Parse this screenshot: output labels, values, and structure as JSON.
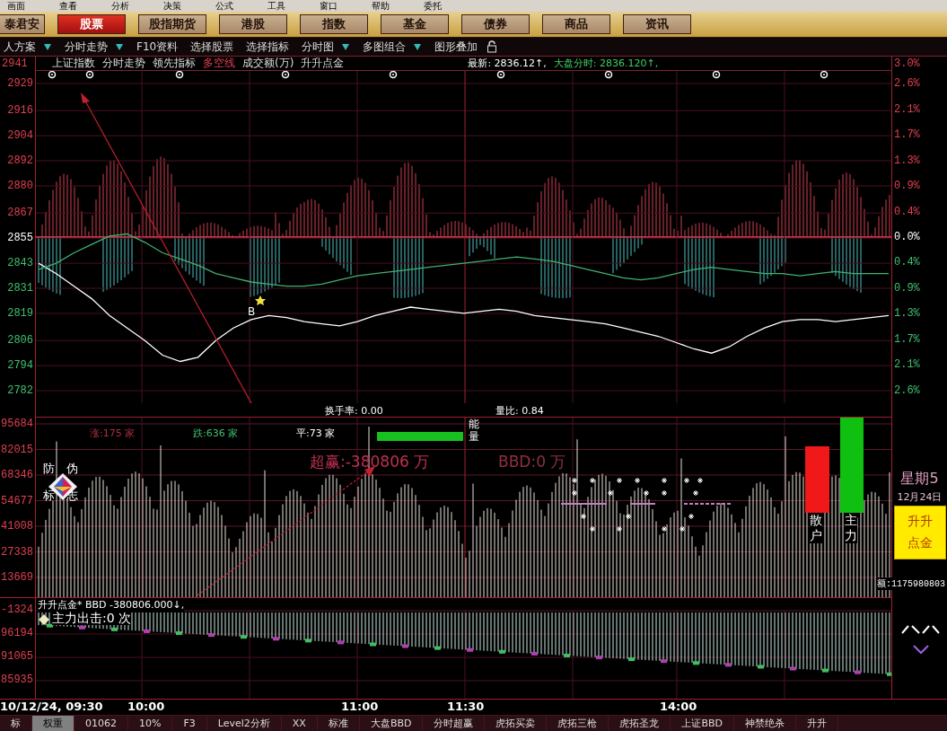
{
  "menu_bar": [
    "画面",
    "查看",
    "分析",
    "决策",
    "公式",
    "工具",
    "窗口",
    "帮助",
    "委托"
  ],
  "market_buttons": [
    {
      "label": "泰君安",
      "selected": false
    },
    {
      "label": "股票",
      "selected": true
    },
    {
      "label": "股指期货",
      "selected": false
    },
    {
      "label": "港股",
      "selected": false
    },
    {
      "label": "指数",
      "selected": false
    },
    {
      "label": "基金",
      "selected": false
    },
    {
      "label": "债券",
      "selected": false
    },
    {
      "label": "商品",
      "selected": false
    },
    {
      "label": "资讯",
      "selected": false
    }
  ],
  "toolbar": [
    {
      "label": "人方案",
      "dropdown": true
    },
    {
      "label": "分时走势",
      "dropdown": true
    },
    {
      "label": "F10资料",
      "dropdown": false
    },
    {
      "label": "选择股票",
      "dropdown": false
    },
    {
      "label": "选择指标",
      "dropdown": false
    },
    {
      "label": "分时图",
      "dropdown": true
    },
    {
      "label": "多图组合",
      "dropdown": true
    },
    {
      "label": "图形叠加",
      "dropdown": false
    }
  ],
  "chart_header": {
    "items": [
      {
        "text": "上证指数",
        "kind": "normal"
      },
      {
        "text": "分时走势",
        "kind": "normal"
      },
      {
        "text": "领先指标",
        "kind": "normal"
      },
      {
        "text": "多空线",
        "kind": "highlight"
      },
      {
        "text": "成交额(万)",
        "kind": "normal"
      },
      {
        "text": "升升点金",
        "kind": "normal"
      }
    ],
    "latest": "最新: 2836.12↑,",
    "index_timeshare": "大盘分时: 2836.120↑,"
  },
  "price_axis_top": {
    "label": "2941",
    "kind": "up"
  },
  "percent_axis": [
    {
      "label": "3.0%",
      "kind": "up"
    },
    {
      "label": "2.6%",
      "kind": "up"
    },
    {
      "label": "2.1%",
      "kind": "up"
    },
    {
      "label": "1.7%",
      "kind": "up"
    },
    {
      "label": "1.3%",
      "kind": "up"
    },
    {
      "label": "0.9%",
      "kind": "up"
    },
    {
      "label": "0.4%",
      "kind": "up"
    },
    {
      "label": "0.0%",
      "kind": "flat"
    },
    {
      "label": "0.4%",
      "kind": "down"
    },
    {
      "label": "0.9%",
      "kind": "down"
    },
    {
      "label": "1.3%",
      "kind": "down"
    },
    {
      "label": "1.7%",
      "kind": "down"
    },
    {
      "label": "2.1%",
      "kind": "down"
    },
    {
      "label": "2.6%",
      "kind": "down"
    }
  ],
  "price_chart": {
    "chart_data": {
      "type": "line",
      "ylim": [
        2776,
        2935
      ],
      "yticks": [
        2929,
        2916,
        2904,
        2892,
        2880,
        2867,
        2855,
        2843,
        2831,
        2819,
        2806,
        2794,
        2782
      ],
      "grid": true,
      "series": [
        {
          "color": "#ffffff",
          "values": [
            2843,
            2838,
            2832,
            2826,
            2818,
            2812,
            2806,
            2799,
            2796,
            2798,
            2806,
            2812,
            2816,
            2818,
            2817,
            2815,
            2814,
            2813,
            2815,
            2818,
            2820,
            2822,
            2821,
            2820,
            2819,
            2820,
            2821,
            2820,
            2818,
            2817,
            2816,
            2815,
            2814,
            2812,
            2810,
            2808,
            2805,
            2802,
            2800,
            2803,
            2808,
            2812,
            2815,
            2816,
            2816,
            2815,
            2816,
            2817,
            2818
          ]
        },
        {
          "color": "#40b070",
          "values": [
            2840,
            2843,
            2848,
            2852,
            2856,
            2857,
            2853,
            2848,
            2845,
            2842,
            2838,
            2836,
            2834,
            2833,
            2832,
            2832,
            2833,
            2835,
            2837,
            2838,
            2839,
            2840,
            2841,
            2842,
            2843,
            2844,
            2845,
            2846,
            2845,
            2844,
            2842,
            2840,
            2838,
            2836,
            2835,
            2836,
            2838,
            2840,
            2841,
            2840,
            2839,
            2838,
            2838,
            2837,
            2838,
            2839,
            2838,
            2838,
            2838
          ]
        }
      ]
    },
    "tick_styles": [
      {
        "kind": "up"
      },
      {
        "kind": "up"
      },
      {
        "kind": "up"
      },
      {
        "kind": "up"
      },
      {
        "kind": "up"
      },
      {
        "kind": "up"
      },
      {
        "kind": "flat"
      },
      {
        "kind": "down"
      },
      {
        "kind": "down"
      },
      {
        "kind": "down"
      },
      {
        "kind": "down"
      },
      {
        "kind": "down"
      },
      {
        "kind": "down"
      }
    ]
  },
  "buy_marker": "B",
  "info_row": {
    "turnover": "换手率: 0.00",
    "volume_ratio": "量比: 0.84"
  },
  "volume_axis": [
    "95684",
    "82015",
    "68346",
    "54677",
    "41008",
    "27338",
    "13669"
  ],
  "volume_pane": {
    "breadth": [
      {
        "text": "涨:175 家",
        "kind": "up"
      },
      {
        "text": "跌:636 家",
        "kind": "down"
      },
      {
        "text": "平:73 家",
        "kind": "flat"
      }
    ],
    "energy_label": "能量",
    "super_win": "超赢:-380806 万",
    "bbd": "BBD:0 万",
    "anti_fake": [
      "防",
      "伪",
      "标",
      "志"
    ],
    "retail_label": "散户",
    "main_force_label": "主力",
    "weekday": "星期5",
    "date": "12月24日",
    "badge": [
      "升升",
      "点金"
    ],
    "amount": "额:1175980803"
  },
  "indicator_axis": [
    "-1324",
    "96194",
    "91065",
    "85935"
  ],
  "indicator_pane": {
    "title": "升升点金* BBD -380806.000↓,",
    "signal": "主力出击:0 次"
  },
  "time_axis": [
    "10/12/24, 09:30",
    "10:00",
    "11:00",
    "11:30",
    "14:00"
  ],
  "bottom_tabs": [
    {
      "label": "标",
      "selected": false
    },
    {
      "label": "权重",
      "selected": true
    },
    {
      "label": "01062",
      "selected": false
    },
    {
      "label": "10%",
      "selected": false
    },
    {
      "label": "F3",
      "selected": false
    },
    {
      "label": "Level2分析",
      "selected": false
    },
    {
      "label": "XX",
      "selected": false
    },
    {
      "label": "标准",
      "selected": false
    },
    {
      "label": "大盘BBD",
      "selected": false
    },
    {
      "label": "分时超赢",
      "selected": false
    },
    {
      "label": "虎拓买卖",
      "selected": false
    },
    {
      "label": "虎拓三枪",
      "selected": false
    },
    {
      "label": "虎拓圣龙",
      "selected": false
    },
    {
      "label": "上证BBD",
      "selected": false
    },
    {
      "label": "神禁绝杀",
      "selected": false
    },
    {
      "label": "升升",
      "selected": false
    }
  ]
}
